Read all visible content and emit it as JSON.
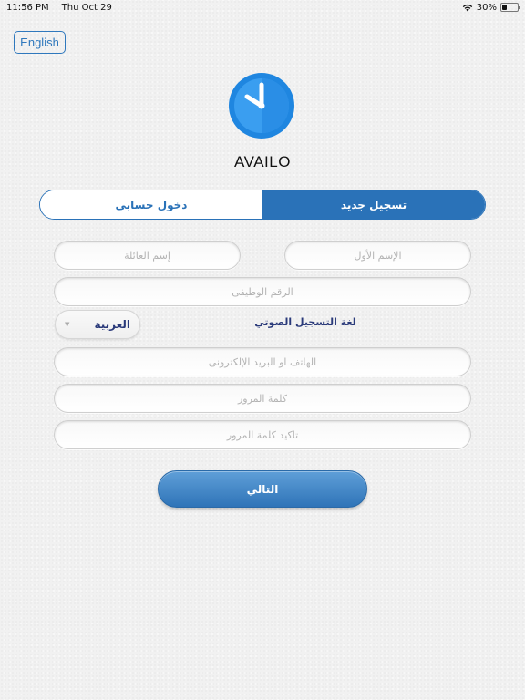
{
  "status_bar": {
    "time": "11:56 PM",
    "date": "Thu Oct 29",
    "battery_percent": "30%",
    "battery_level": 0.3,
    "icons": [
      "wifi-icon",
      "battery-icon"
    ]
  },
  "header": {
    "language_button_label": "English",
    "logo_icon": "clock-logo-icon",
    "app_name": "AVAILO"
  },
  "tabs": {
    "login_label": "دخول حسابي",
    "register_label": "تسجيل جديد",
    "active": "register"
  },
  "form": {
    "first_name_placeholder": "الإسم الأول",
    "last_name_placeholder": "إسم العائلة",
    "job_number_placeholder": "الرقم الوظيفى",
    "voice_language_label": "لغة التسجيل الصوتي",
    "voice_language_value": "العربية",
    "phone_email_placeholder": "الهاتف او البريد الإلكترونى",
    "password_placeholder": "كلمة المرور",
    "confirm_password_placeholder": "تاكيد كلمة المرور"
  },
  "actions": {
    "next_label": "التالي"
  },
  "colors": {
    "accent": "#2a72b8",
    "logo_blue": "#1f86e0",
    "background": "#f1f1f1"
  }
}
